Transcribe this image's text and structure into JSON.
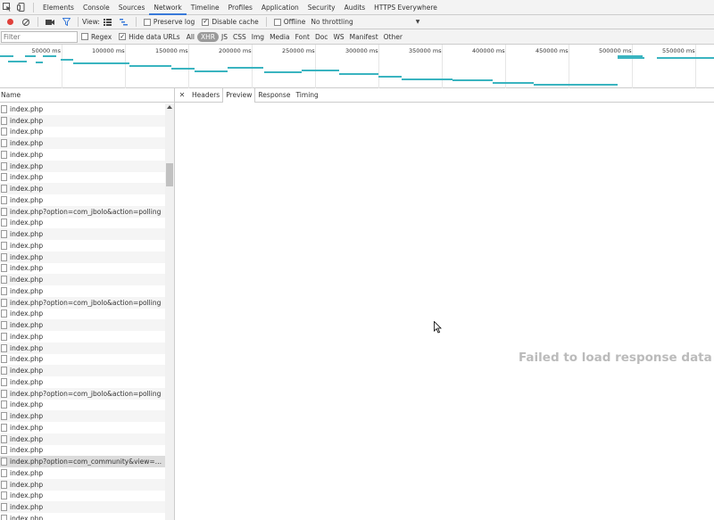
{
  "tabbar": {
    "tabs": [
      {
        "label": "Elements",
        "active": false
      },
      {
        "label": "Console",
        "active": false
      },
      {
        "label": "Sources",
        "active": false
      },
      {
        "label": "Network",
        "active": true
      },
      {
        "label": "Timeline",
        "active": false
      },
      {
        "label": "Profiles",
        "active": false
      },
      {
        "label": "Application",
        "active": false
      },
      {
        "label": "Security",
        "active": false
      },
      {
        "label": "Audits",
        "active": false
      },
      {
        "label": "HTTPS Everywhere",
        "active": false
      }
    ]
  },
  "toolbar": {
    "view_label": "View:",
    "preserve_log": {
      "label": "Preserve log",
      "checked": false
    },
    "disable_cache": {
      "label": "Disable cache",
      "checked": true
    },
    "offline": {
      "label": "Offline",
      "checked": false
    },
    "throttle": "No throttling"
  },
  "filter": {
    "placeholder": "Filter",
    "regex": {
      "label": "Regex",
      "checked": false
    },
    "hide_data_urls": {
      "label": "Hide data URLs",
      "checked": true
    },
    "types": [
      {
        "label": "All",
        "active": false
      },
      {
        "label": "XHR",
        "active": true
      },
      {
        "label": "JS",
        "active": false
      },
      {
        "label": "CSS",
        "active": false
      },
      {
        "label": "Img",
        "active": false
      },
      {
        "label": "Media",
        "active": false
      },
      {
        "label": "Font",
        "active": false
      },
      {
        "label": "Doc",
        "active": false
      },
      {
        "label": "WS",
        "active": false
      },
      {
        "label": "Manifest",
        "active": false
      },
      {
        "label": "Other",
        "active": false
      }
    ]
  },
  "overview": {
    "tick_labels": [
      "50000 ms",
      "100000 ms",
      "150000 ms",
      "200000 ms",
      "250000 ms",
      "300000 ms",
      "350000 ms",
      "400000 ms",
      "450000 ms",
      "500000 ms",
      "550000 ms"
    ]
  },
  "requests": {
    "column_name": "Name",
    "rows": [
      "index.php",
      "index.php",
      "index.php",
      "index.php",
      "index.php",
      "index.php",
      "index.php",
      "index.php",
      "index.php",
      "index.php?option=com_jbolo&action=polling",
      "index.php",
      "index.php",
      "index.php",
      "index.php",
      "index.php",
      "index.php",
      "index.php",
      "index.php?option=com_jbolo&action=polling",
      "index.php",
      "index.php",
      "index.php",
      "index.php",
      "index.php",
      "index.php",
      "index.php",
      "index.php?option=com_jbolo&action=polling",
      "index.php",
      "index.php",
      "index.php",
      "index.php",
      "index.php",
      "index.php?option=com_community&view=videos&task=...",
      "index.php",
      "index.php",
      "index.php",
      "index.php",
      "index.php"
    ],
    "selected_index": 31
  },
  "detail": {
    "tabs": [
      {
        "label": "Headers",
        "active": false
      },
      {
        "label": "Preview",
        "active": true
      },
      {
        "label": "Response",
        "active": false
      },
      {
        "label": "Timing",
        "active": false
      }
    ],
    "message": "Failed to load response data"
  },
  "colors": {
    "accent": "#3879d9",
    "record": "#e0403a",
    "timeline": "#3ab4c0"
  }
}
